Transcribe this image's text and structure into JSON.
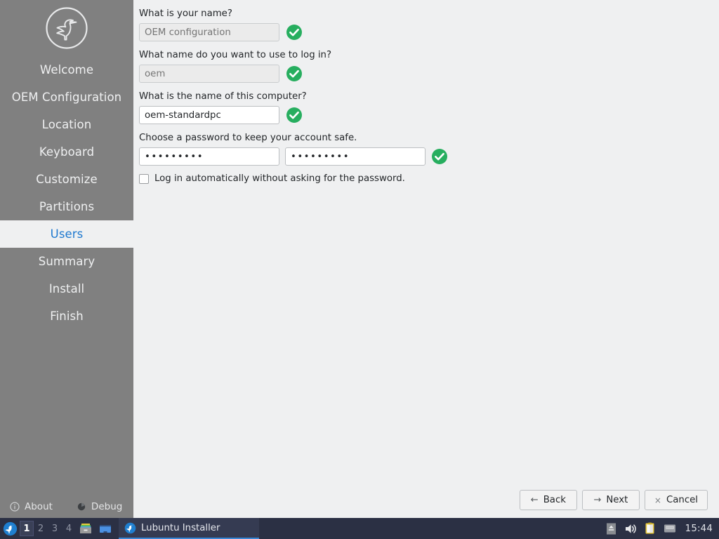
{
  "sidebar": {
    "logo_icon": "lubuntu-bird-logo",
    "items": [
      {
        "label": "Welcome",
        "active": false
      },
      {
        "label": "OEM Configuration",
        "active": false
      },
      {
        "label": "Location",
        "active": false
      },
      {
        "label": "Keyboard",
        "active": false
      },
      {
        "label": "Customize",
        "active": false
      },
      {
        "label": "Partitions",
        "active": false
      },
      {
        "label": "Users",
        "active": true
      },
      {
        "label": "Summary",
        "active": false
      },
      {
        "label": "Install",
        "active": false
      },
      {
        "label": "Finish",
        "active": false
      }
    ],
    "footer": {
      "about_label": "About",
      "about_icon": "info-circle-icon",
      "debug_label": "Debug",
      "debug_icon": "debug-circle-icon"
    },
    "bg_color": "#808080",
    "active_text_color": "#1d78cf",
    "active_bg_color": "#eff0f1"
  },
  "main": {
    "fields": {
      "fullname": {
        "question": "What is your name?",
        "value": "",
        "placeholder": "OEM configuration",
        "disabled": true,
        "valid_icon": "green-check-icon"
      },
      "username": {
        "question": "What name do you want to use to log in?",
        "value": "",
        "placeholder": "oem",
        "disabled": true,
        "valid_icon": "green-check-icon"
      },
      "hostname": {
        "question": "What is the name of this computer?",
        "value": "oem-standardpc",
        "placeholder": "",
        "disabled": false,
        "valid_icon": "green-check-icon"
      },
      "password": {
        "question": "Choose a password to keep your account safe.",
        "value": "•••••••••",
        "repeat_value": "•••••••••",
        "valid_icon": "green-check-icon"
      }
    },
    "autologin": {
      "label": "Log in automatically without asking for the password.",
      "checked": false
    },
    "valid_color": "#27ae5f",
    "bg_color": "#eff0f1"
  },
  "buttons": {
    "back": {
      "label": "Back",
      "glyph": "←",
      "icon": "arrow-left-icon"
    },
    "next": {
      "label": "Next",
      "glyph": "→",
      "icon": "arrow-right-icon"
    },
    "cancel": {
      "label": "Cancel",
      "glyph": "×",
      "icon": "close-x-icon"
    }
  },
  "taskbar": {
    "menu_icon": "lubuntu-start-icon",
    "workspaces": [
      {
        "label": "1",
        "active": true
      },
      {
        "label": "2",
        "active": false
      },
      {
        "label": "3",
        "active": false
      },
      {
        "label": "4",
        "active": false
      }
    ],
    "launchers": [
      {
        "icon": "file-manager-icon"
      },
      {
        "icon": "terminal-icon"
      }
    ],
    "windows": [
      {
        "title": "Lubuntu Installer",
        "icon": "lubuntu-bird-icon",
        "active": true
      }
    ],
    "tray": [
      {
        "icon": "eject-icon"
      },
      {
        "icon": "volume-icon"
      },
      {
        "icon": "clipboard-icon"
      },
      {
        "icon": "network-icon"
      }
    ],
    "clock": "15:44",
    "bg_color": "#2b3044"
  }
}
